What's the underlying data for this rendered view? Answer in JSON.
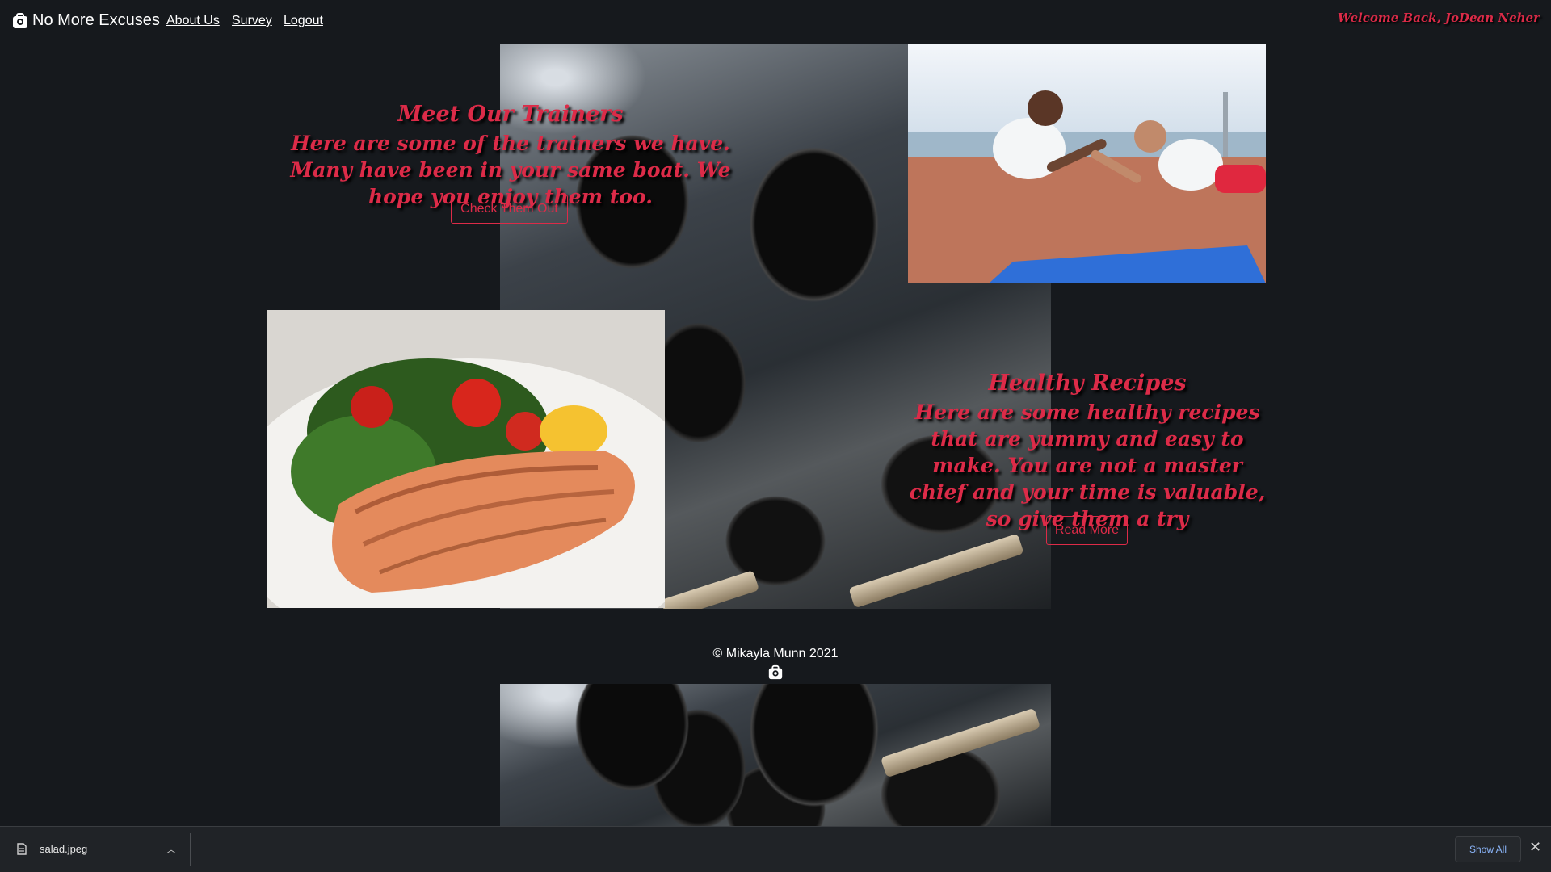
{
  "navbar": {
    "brand": "No More Excuses",
    "links": [
      "About Us",
      "Survey",
      "Logout"
    ],
    "welcome": "Welcome Back, JoDean Neher"
  },
  "trainers": {
    "title": "Meet Our Trainers",
    "text": "Here are some of the trainers we have. Many have been in your same boat. We hope you enjoy them too.",
    "button": "Check Them Out"
  },
  "recipes": {
    "title": "Healthy Recipes",
    "text": "Here are some healthy recipes that are yummy and easy to make. You are not a master chief and your time is valuable, so give them a try",
    "button": "Read More"
  },
  "footer": {
    "copyright": "© Mikayla Munn 2021"
  },
  "download_bar": {
    "filename": "salad.jpeg",
    "show_all": "Show All"
  },
  "colors": {
    "accent": "#dc2b48",
    "background": "#16191d"
  },
  "icons": {
    "brand": "camera-bag-icon",
    "download_file": "file-icon",
    "expand": "chevron-up-icon",
    "close": "close-icon"
  }
}
